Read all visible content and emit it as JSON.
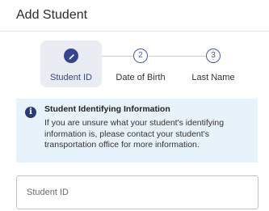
{
  "header": {
    "title": "Add Student"
  },
  "stepper": {
    "steps": [
      {
        "label": "Student ID",
        "number": "",
        "state": "active-edit",
        "icon": "pencil-icon"
      },
      {
        "label": "Date of Birth",
        "number": "2",
        "state": "pending"
      },
      {
        "label": "Last Name",
        "number": "3",
        "state": "pending"
      }
    ]
  },
  "info": {
    "icon": "info-icon",
    "title": "Student Identifying Information",
    "body": "If you are unsure what your student's identifying information is, please contact your student's transportation office for more information."
  },
  "form": {
    "student_id": {
      "value": "",
      "placeholder": "Student ID"
    }
  },
  "colors": {
    "accent": "#37458f",
    "info_bg": "#e8f2fb",
    "active_step_bg": "#e9ecf3"
  }
}
